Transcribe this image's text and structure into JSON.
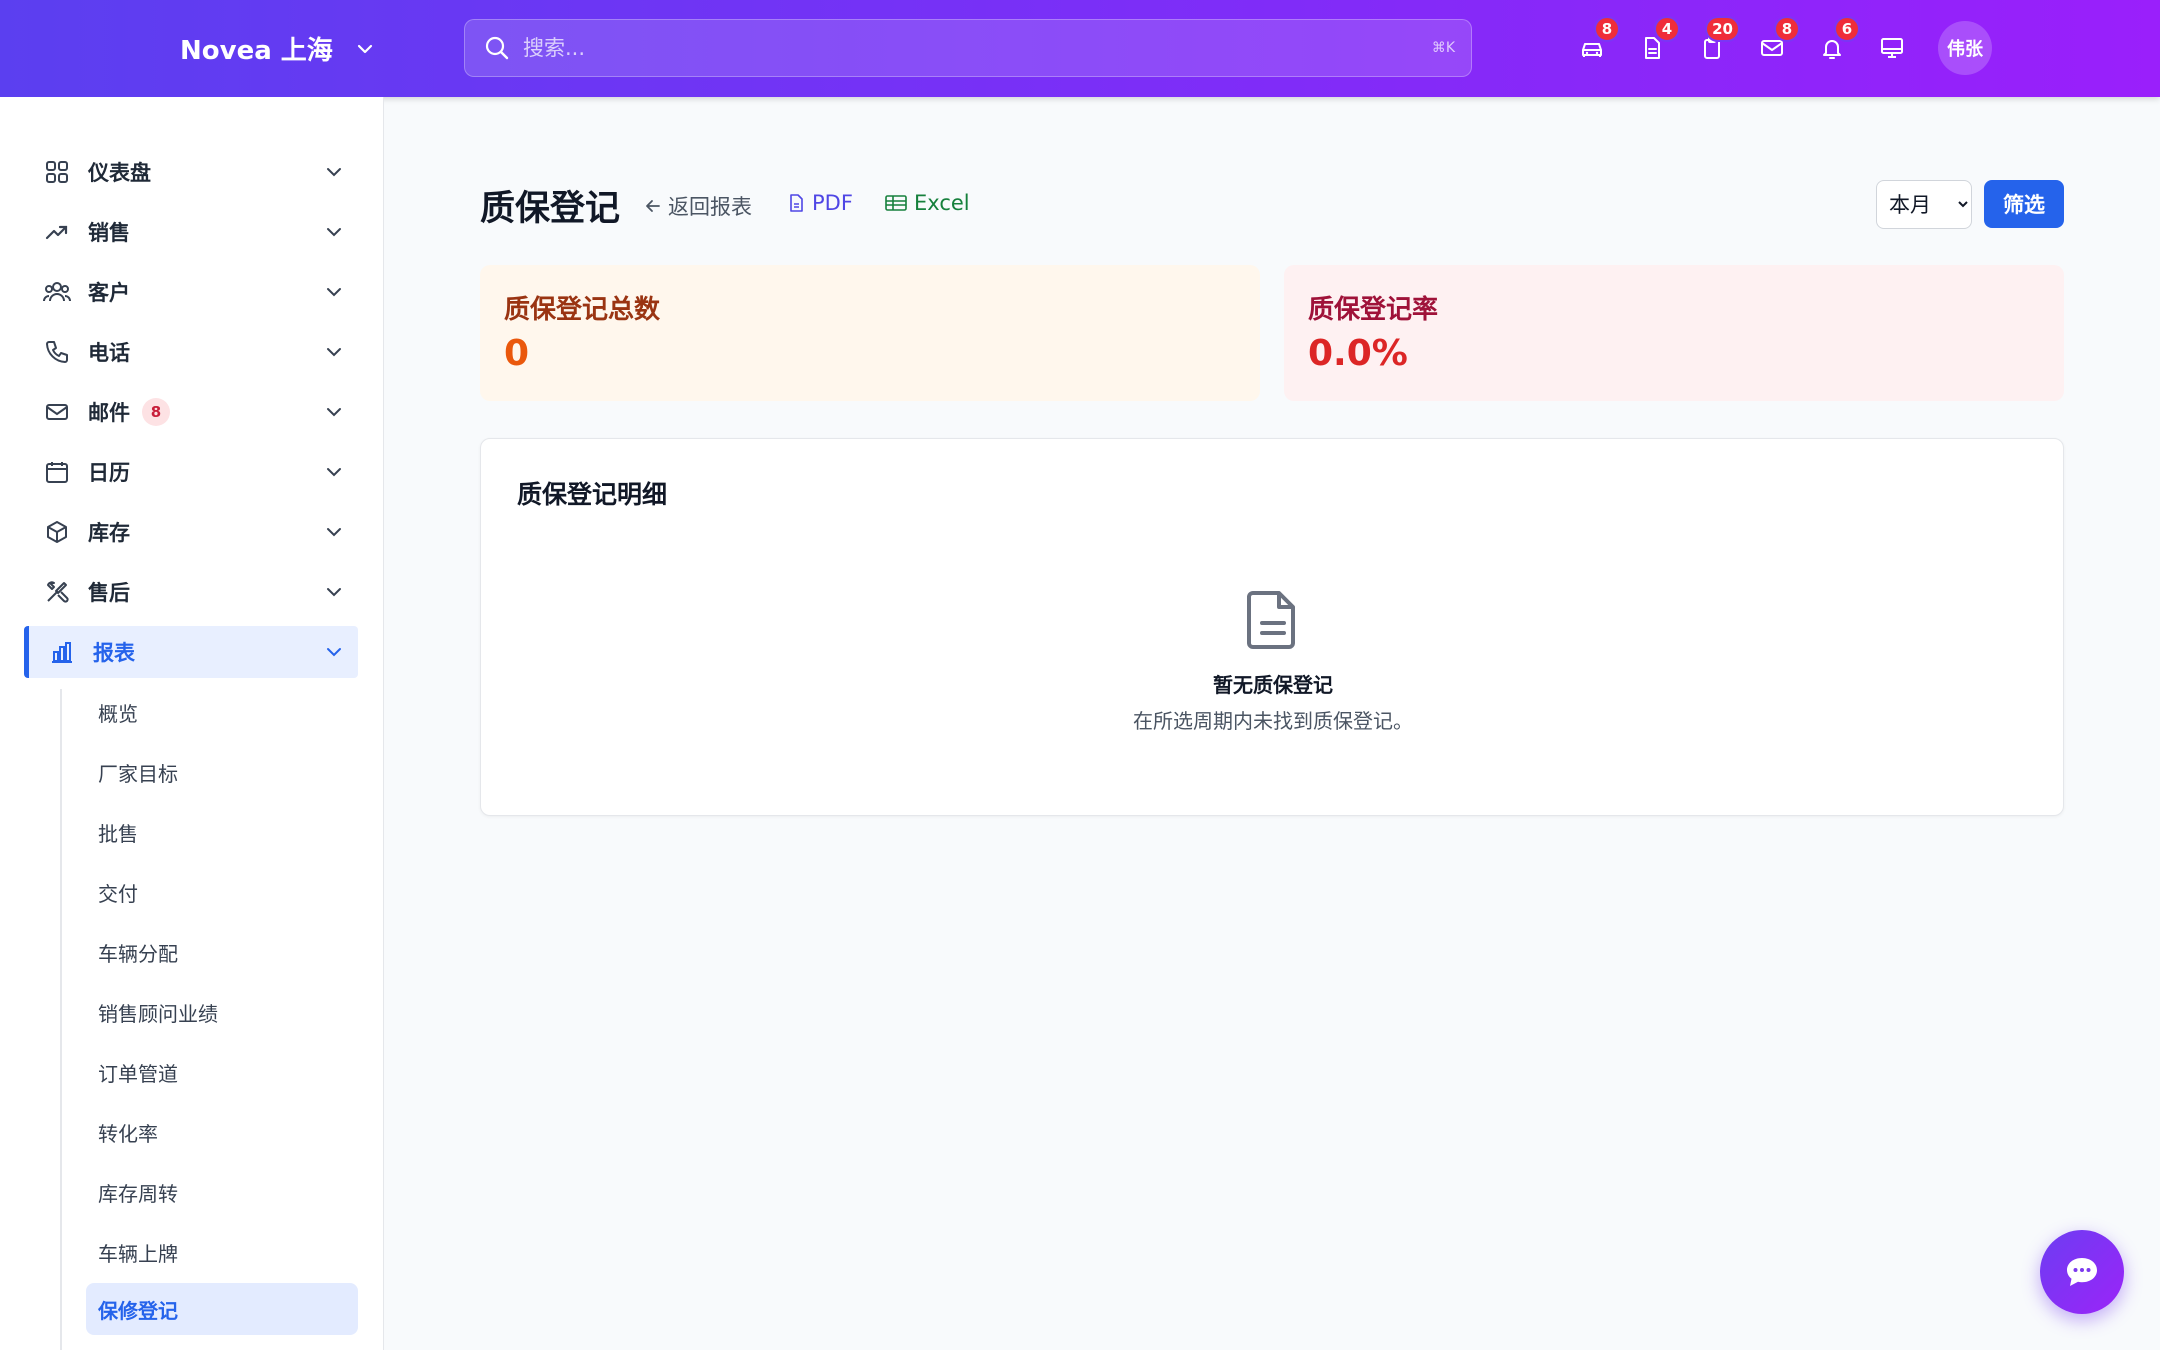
{
  "header": {
    "brand": "Novea 上海",
    "search_placeholder": "搜索...",
    "search_shortcut": "⌘K",
    "icons": [
      {
        "name": "car-icon",
        "badge": "8"
      },
      {
        "name": "document-icon",
        "badge": "4"
      },
      {
        "name": "clipboard-icon",
        "badge": "20"
      },
      {
        "name": "mail-icon",
        "badge": "8"
      },
      {
        "name": "bell-icon",
        "badge": "6"
      },
      {
        "name": "monitor-icon",
        "badge": ""
      }
    ],
    "avatar_text": "伟张"
  },
  "sidebar": {
    "items": [
      {
        "label": "仪表盘",
        "icon": "grid-icon"
      },
      {
        "label": "销售",
        "icon": "trend-icon"
      },
      {
        "label": "客户",
        "icon": "users-icon"
      },
      {
        "label": "电话",
        "icon": "phone-icon"
      },
      {
        "label": "邮件",
        "icon": "mail-icon",
        "badge": "8"
      },
      {
        "label": "日历",
        "icon": "calendar-icon"
      },
      {
        "label": "库存",
        "icon": "box-icon"
      },
      {
        "label": "售后",
        "icon": "tools-icon"
      },
      {
        "label": "报表",
        "icon": "bar-chart-icon",
        "active": true
      }
    ],
    "sub_items": [
      {
        "label": "概览"
      },
      {
        "label": "厂家目标"
      },
      {
        "label": "批售"
      },
      {
        "label": "交付"
      },
      {
        "label": "车辆分配"
      },
      {
        "label": "销售顾问业绩"
      },
      {
        "label": "订单管道"
      },
      {
        "label": "转化率"
      },
      {
        "label": "库存周转"
      },
      {
        "label": "车辆上牌"
      },
      {
        "label": "保修登记",
        "active": true
      }
    ]
  },
  "main": {
    "title": "质保登记",
    "back_link": "返回报表",
    "pdf_link": "PDF",
    "excel_link": "Excel",
    "period_selected": "本月",
    "filter_button": "筛选",
    "stats": [
      {
        "label": "质保登记总数",
        "value": "0"
      },
      {
        "label": "质保登记率",
        "value": "0.0%"
      }
    ],
    "detail": {
      "title": "质保登记明细",
      "empty_title": "暂无质保登记",
      "empty_subtitle": "在所选周期内未找到质保登记。"
    }
  },
  "colors": {
    "accent": "#2563eb",
    "header_gradient_start": "#5b3ff0",
    "header_gradient_end": "#9a1ffb",
    "badge": "#ef2d3a"
  }
}
